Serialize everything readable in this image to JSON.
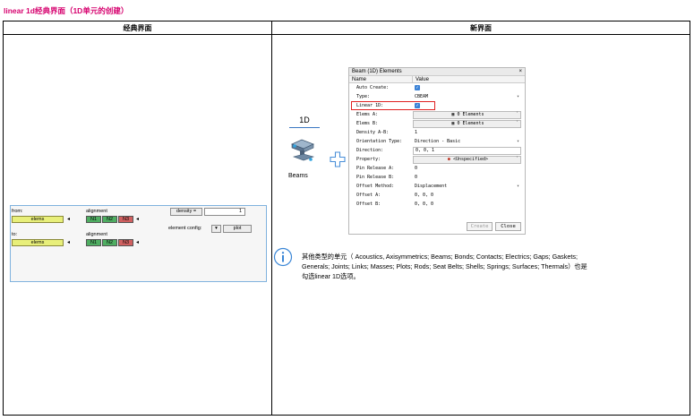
{
  "page_title": "linear 1d经典界面（1D单元的创建）",
  "table": {
    "col_classic": "经典界面",
    "col_new": "新界面"
  },
  "classic": {
    "from_label": "from:",
    "to_label": "to:",
    "elems_label": "elems",
    "alignment_label": "alignment",
    "n1": "N1",
    "n2": "N2",
    "n3": "N3",
    "density_label": "density =",
    "density_value": "1",
    "element_config_label": "element config:",
    "plot_label": "plot"
  },
  "new": {
    "tab_label": "1D",
    "beams_label": "Beams",
    "dialog": {
      "title": "Beam (1D) Elements",
      "close": "×",
      "col_name": "Name",
      "col_value": "Value",
      "rows": {
        "auto_create": {
          "name": "Auto Create:",
          "value": "✓"
        },
        "type": {
          "name": "Type:",
          "value": "CBEAM"
        },
        "linear_1d": {
          "name": "Linear 1D:",
          "value": "✓"
        },
        "elems_a": {
          "name": "Elems A:",
          "value": "0 Elements"
        },
        "elems_b": {
          "name": "Elems B:",
          "value": "0 Elements"
        },
        "density": {
          "name": "Density A-B:",
          "value": "1"
        },
        "orientation": {
          "name": "Orientation Type:",
          "value": "Direction - Basic"
        },
        "direction": {
          "name": "Direction:",
          "value": "0, 0, 1"
        },
        "property": {
          "name": "Property:",
          "value": "<Unspecified>"
        },
        "pin_a": {
          "name": "Pin Release A:",
          "value": "0"
        },
        "pin_b": {
          "name": "Pin Release B:",
          "value": "0"
        },
        "offset_method": {
          "name": "Offset Method:",
          "value": "Displacement"
        },
        "offset_a": {
          "name": "Offset A:",
          "value": "0, 0, 0"
        },
        "offset_b": {
          "name": "Offset B:",
          "value": "0, 0, 0"
        }
      },
      "create_button": "Create",
      "close_button": "Close"
    },
    "info_text": "其他类型的单元（ Acoustics, Axisymmetrics; Beams; Bonds; Contacts; Electrics; Gaps; Gaskets; Generals; Joints; Links; Masses; Plots; Rods; Seat Belts; Shells; Springs; Surfaces; Thermals）也是勾选linear 1D选项。"
  },
  "colors": {
    "title": "#d6006e",
    "elems_yellow": "#e8ef7a",
    "node_green": "#4fae62",
    "node_red": "#d06060",
    "accent_blue": "#3b82d6",
    "highlight_red": "#e02020"
  }
}
